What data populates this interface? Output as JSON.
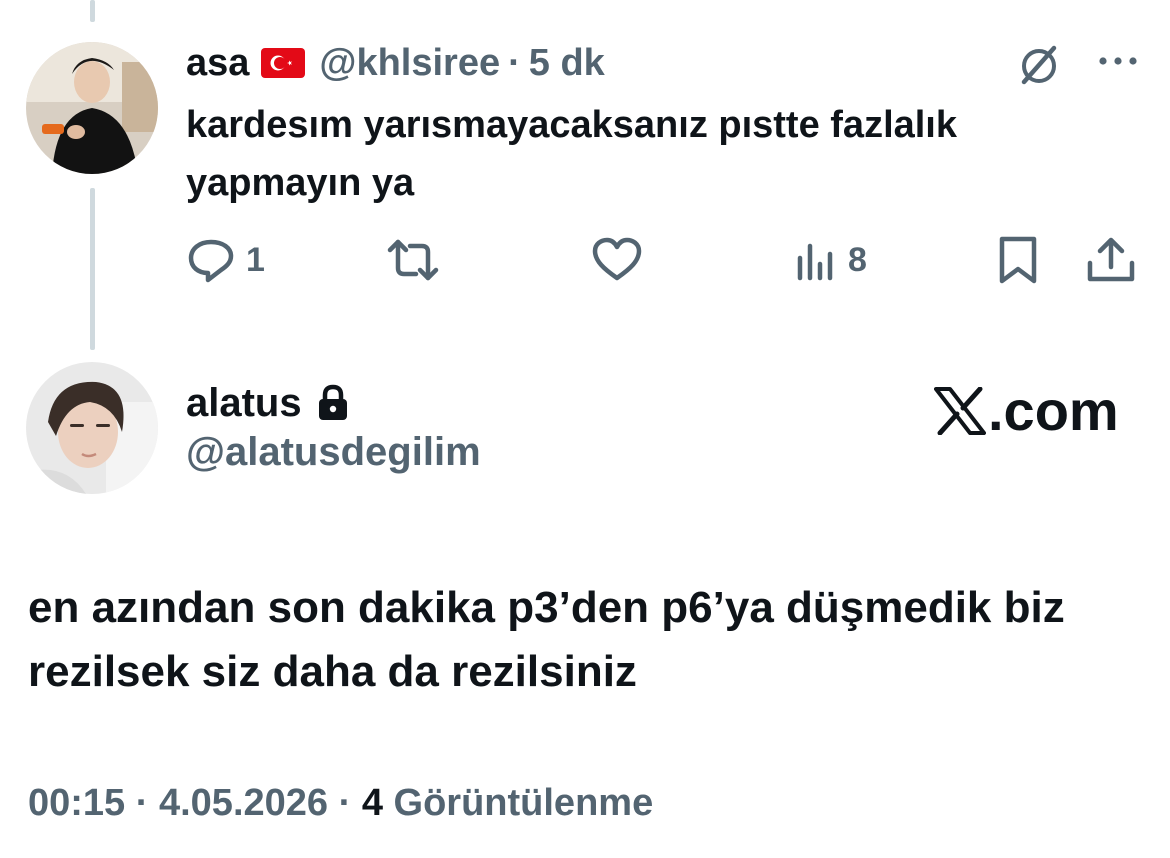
{
  "parent_tweet": {
    "author_name": "asa",
    "flag_icon": "turkey-flag-icon",
    "handle": "@khlsiree",
    "separator": "·",
    "time": "5 dk",
    "text": "kardesım yarısmayacaksanız pıstte fazlalık yapmayın ya",
    "actions": {
      "reply_count": "1",
      "retweet_count": "",
      "like_count": "",
      "views_count": "8"
    }
  },
  "quoted_reply": {
    "author_name": "alatus",
    "protected_icon": "lock-icon",
    "handle": "@alatusdegilim",
    "text": "en azından son dakika p3’den p6’ya düşmedik biz rezilsek siz daha da rezilsiniz",
    "time": "00:15",
    "date": "4.05.2026",
    "separator": "·",
    "views_count": "4",
    "views_label": "Görüntülenme"
  },
  "watermark": {
    "logo_icon": "x-logo-icon",
    "text": ".com"
  },
  "colors": {
    "text_primary": "#0f1419",
    "text_secondary": "#536471",
    "thread_line": "#cfd9de",
    "flag_red": "#e30a17"
  }
}
